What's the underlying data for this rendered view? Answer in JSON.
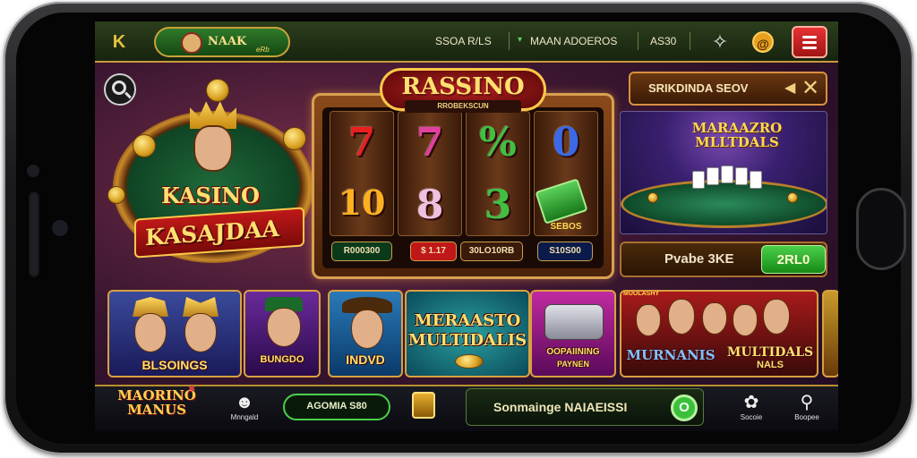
{
  "topbar": {
    "back_icon": "K",
    "brand_name": "NAAK",
    "brand_sub": "eRb",
    "text_1": "SSOA R/LS",
    "text_2": "MAAN ADOEROS",
    "text_3": "AS30",
    "star_icon": "star-outline-icon",
    "coin_label": "@",
    "menu_icon": "hamburger-menu-icon"
  },
  "hero": {
    "title_top": "KASINO",
    "title_banner": "KASAJDAA"
  },
  "slot": {
    "title": "RASSINO",
    "subtitle": "RROBEKSCUN",
    "symbols_row1": [
      "7",
      "7",
      "%",
      "0"
    ],
    "symbols_row2": [
      "10",
      "8",
      "3",
      ""
    ],
    "symbol_colors_row1": [
      "#e82020",
      "#e040a0",
      "#40c040",
      "#3a6ae8"
    ],
    "symbol_colors_row2": [
      "#ffb020",
      "#f0c0e0",
      "#40c040",
      "#40c040"
    ],
    "reel4_label": "SEBOS",
    "bottom_labels": [
      "R000300",
      "$ 1.17",
      "30LO10RB",
      "S10S00"
    ]
  },
  "promo": {
    "label": "SRIKDINDA SEOV",
    "close_icon": "close-icon"
  },
  "table_card": {
    "title_line1": "MARAAZRO",
    "title_line2": "MLLTDALS"
  },
  "jackpot": {
    "label": "Pvabe 3KE",
    "value": "2RL0"
  },
  "tiles": [
    {
      "label": "BLSOINGS"
    },
    {
      "label": "BUNGDO"
    },
    {
      "label": "INDVD"
    },
    {
      "label_1": "MERAASTO",
      "label_2": "MULTIDALIS"
    },
    {
      "label_1": "OOPAIINING",
      "label_2": "PAYNEN"
    },
    {
      "label_1": "MURNANIS",
      "label_2": "MULTIDALS",
      "label_3": "NALS",
      "badge": "MUOLASHY"
    }
  ],
  "bottombar": {
    "logo_line1": "MAORINO",
    "logo_line2": "MANUS",
    "nav_1_label": "Mnngald",
    "pill_1": "AGOMIA S80",
    "pill_2_text": "Sonmainge NAIAEISSI",
    "pill_2_badge": "O",
    "nav_2_label": "Socoie",
    "nav_3_label": "Boopee"
  }
}
